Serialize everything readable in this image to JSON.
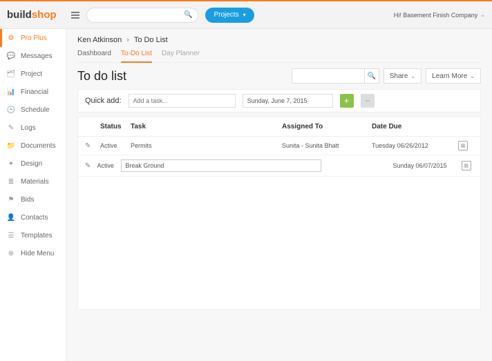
{
  "logo": {
    "part1": "build",
    "part2": "shop"
  },
  "header": {
    "projects_label": "Projects",
    "company_greeting": "Hi! Basement Finish Company"
  },
  "sidebar": {
    "items": [
      {
        "label": "Pro Plus",
        "icon": "⚙",
        "active": true
      },
      {
        "label": "Messages",
        "icon": "💬"
      },
      {
        "label": "Project",
        "icon": "🗂"
      },
      {
        "label": "Financial",
        "icon": "📊"
      },
      {
        "label": "Schedule",
        "icon": "🕒"
      },
      {
        "label": "Logs",
        "icon": "✎"
      },
      {
        "label": "Documents",
        "icon": "📁"
      },
      {
        "label": "Design",
        "icon": "✦"
      },
      {
        "label": "Materials",
        "icon": "≣"
      },
      {
        "label": "Bids",
        "icon": "⚑"
      },
      {
        "label": "Contacts",
        "icon": "👤"
      },
      {
        "label": "Templates",
        "icon": "☰"
      },
      {
        "label": "Hide Menu",
        "icon": "⊕"
      }
    ]
  },
  "breadcrumb": {
    "user": "Ken Atkinson",
    "page": "To Do List"
  },
  "tabs": [
    {
      "label": "Dashboard"
    },
    {
      "label": "To-Do List",
      "active": true
    },
    {
      "label": "Day Planner"
    }
  ],
  "page_title": "To do list",
  "actions": {
    "share": "Share",
    "learn_more": "Learn More"
  },
  "quickadd": {
    "label": "Quick add:",
    "task_placeholder": "Add a task...",
    "date_value": "Sunday, June 7, 2015"
  },
  "table": {
    "headers": {
      "status": "Status",
      "task": "Task",
      "assigned": "Assigned To",
      "due": "Date Due"
    },
    "rows": [
      {
        "status": "Active",
        "task": "Permits",
        "assigned": "Sunita - Sunita Bhatt",
        "due": "Tuesday 06/26/2012",
        "editing": false
      },
      {
        "status": "Active",
        "task": "Break Ground",
        "assigned": "",
        "due": "Sunday 06/07/2015",
        "editing": true
      }
    ]
  }
}
